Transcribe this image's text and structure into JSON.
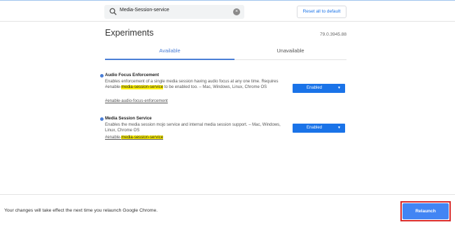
{
  "search": {
    "value": "Media-Session-service",
    "icon": "search-icon"
  },
  "header": {
    "reset_label": "Reset all to default"
  },
  "main": {
    "title": "Experiments",
    "version": "79.0.3945.88",
    "tabs": [
      {
        "label": "Available",
        "active": true
      },
      {
        "label": "Unavailable",
        "active": false
      }
    ]
  },
  "experiments": [
    {
      "title": "Audio Focus Enforcement",
      "desc_pre": "Enables enforcement of a single media session having audio focus at any one time. Requires #enable-",
      "desc_hl": "media-session-service",
      "desc_post": " to be enabled too. – Mac, Windows, Linux, Chrome OS",
      "link_pre": "#enable-audio-focus-enforcement",
      "link_hl": "",
      "select": "Enabled"
    },
    {
      "title": "Media Session Service",
      "desc_pre": "Enables the media session mojo service and internal media session support. – Mac, Windows, Linux, Chrome OS",
      "desc_hl": "",
      "desc_post": "",
      "link_pre": "#enable-",
      "link_hl": "media-session-service",
      "select": "Enabled"
    }
  ],
  "footer": {
    "message": "Your changes will take effect the next time you relaunch Google Chrome.",
    "relaunch_label": "Relaunch"
  },
  "colors": {
    "accent": "#1a73e8",
    "highlight": "#fff200",
    "relaunch_outline": "#d92c2c"
  }
}
